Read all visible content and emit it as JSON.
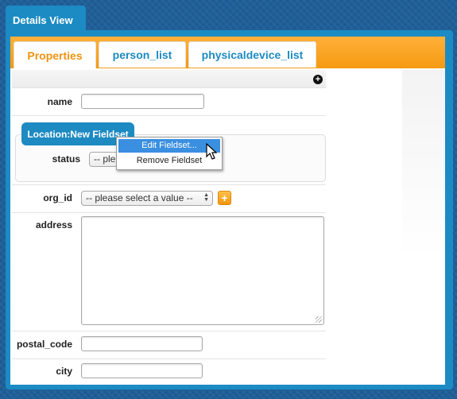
{
  "window": {
    "title": "Details View"
  },
  "tabs": [
    {
      "label": "Properties"
    },
    {
      "label": "person_list"
    },
    {
      "label": "physicaldevice_list"
    }
  ],
  "fields": {
    "name": {
      "label": "name",
      "value": ""
    },
    "fieldset": {
      "legend": "Location:New Fieldset"
    },
    "status": {
      "label": "status",
      "value": "-- ple"
    },
    "org_id": {
      "label": "org_id",
      "value": "-- please select a value --",
      "add_label": "+"
    },
    "address": {
      "label": "address",
      "value": ""
    },
    "postal_code": {
      "label": "postal_code",
      "value": ""
    },
    "city": {
      "label": "city",
      "value": ""
    }
  },
  "context_menu": {
    "items": [
      {
        "label": "Edit Fieldset..."
      },
      {
        "label": "Remove Fieldset"
      }
    ]
  },
  "toolbar": {
    "add_icon": "plus-circle-icon"
  },
  "colors": {
    "accent_blue": "#1d8ac2",
    "accent_orange": "#f59a12",
    "menu_highlight": "#3a8fe0"
  }
}
